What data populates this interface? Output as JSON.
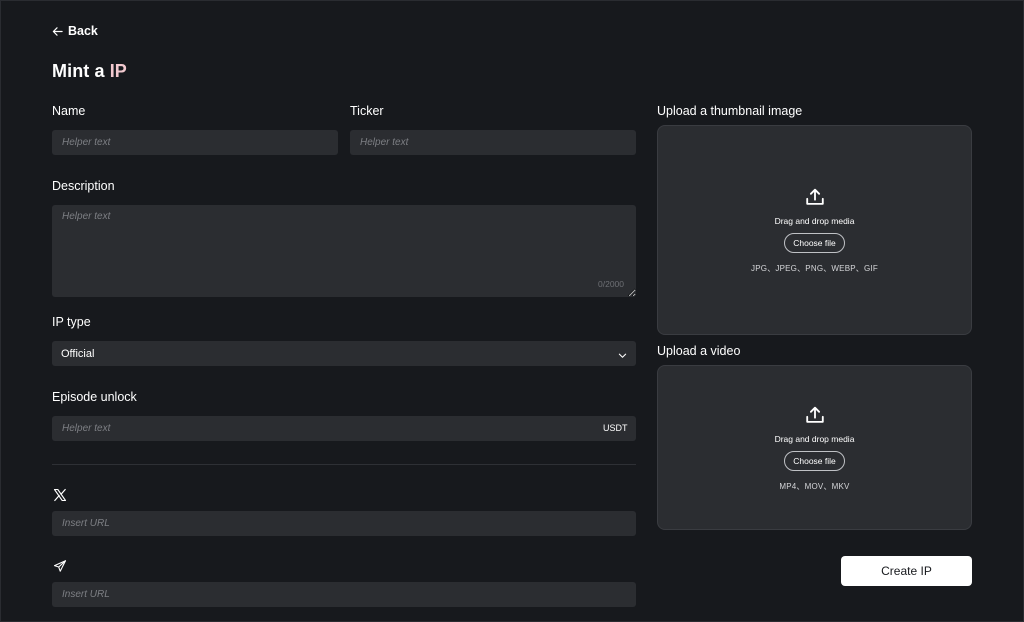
{
  "header": {
    "back_label": "Back",
    "title_main": "Mint a ",
    "title_accent": "IP"
  },
  "form": {
    "name": {
      "label": "Name",
      "placeholder": "Helper text",
      "value": ""
    },
    "ticker": {
      "label": "Ticker",
      "placeholder": "Helper text",
      "value": ""
    },
    "description": {
      "label": "Description",
      "placeholder": "Helper text",
      "value": "",
      "counter": "0/2000"
    },
    "ip_type": {
      "label": "IP type",
      "selected": "Official"
    },
    "episode_unlock": {
      "label": "Episode unlock",
      "placeholder": "Helper text",
      "unit": "USDT",
      "value": ""
    },
    "x_link": {
      "icon": "x-logo-icon",
      "placeholder": "Insert URL",
      "value": ""
    },
    "telegram_link": {
      "icon": "telegram-icon",
      "placeholder": "Insert URL",
      "value": ""
    }
  },
  "uploads": {
    "thumbnail": {
      "label": "Upload a thumbnail image",
      "title": "Drag and drop media",
      "button": "Choose file",
      "formats": "JPG、JPEG、PNG、WEBP、GIF"
    },
    "video": {
      "label": "Upload a video",
      "title": "Drag and drop media",
      "button": "Choose file",
      "formats": "MP4、MOV、MKV"
    }
  },
  "actions": {
    "create_label": "Create IP"
  },
  "colors": {
    "background": "#17191d",
    "field": "#2b2d31",
    "title_accent": "#f2c9cf",
    "button": "#ffffff"
  }
}
